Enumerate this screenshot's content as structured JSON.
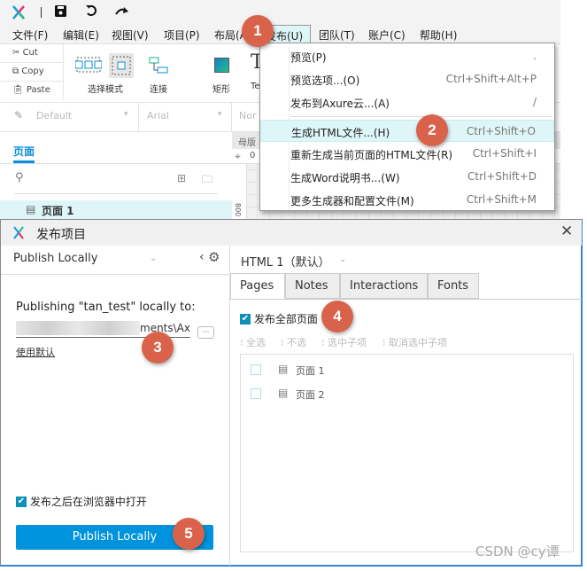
{
  "colors": {
    "accent": "#0093dd",
    "badge": "#d9634a",
    "highlight": "#dff6f8",
    "checkbox": "#0e90b8"
  },
  "titlebar": {
    "icons": [
      "axure-logo-icon",
      "save-icon",
      "undo-icon",
      "redo-icon"
    ]
  },
  "menubar": {
    "items": [
      "文件(F)",
      "编辑(E)",
      "视图(V)",
      "项目(P)",
      "布局(A)",
      "发布(U)",
      "团队(T)",
      "账户(C)",
      "帮助(H)"
    ],
    "active_index": 5
  },
  "toolbar": {
    "cut": "Cut",
    "copy": "Copy",
    "paste": "Paste",
    "select_mode": "选择模式",
    "connect": "连接",
    "rectangle": "矩形",
    "text": "Te"
  },
  "stylebar": {
    "style": "Default",
    "font": "Arial",
    "weight": "Nor"
  },
  "pages_panel": {
    "tab": "页面",
    "items": [
      "页面 1"
    ],
    "masters_tab": "母版",
    "ruler_zero": "0",
    "ruler_side": "800"
  },
  "publish_menu": {
    "items": [
      {
        "label": "预览(P)",
        "shortcut": "."
      },
      {
        "label": "预览选项...(O)",
        "shortcut": "Ctrl+Shift+Alt+P"
      },
      {
        "label": "发布到Axure云...(A)",
        "shortcut": "/"
      },
      {
        "label": "生成HTML文件...(H)",
        "shortcut": "Ctrl+Shift+O",
        "highlighted": true
      },
      {
        "label": "重新生成当前页面的HTML文件(R)",
        "shortcut": "Ctrl+Shift+I"
      },
      {
        "label": "生成Word说明书...(W)",
        "shortcut": "Ctrl+Shift+D"
      },
      {
        "label": "更多生成器和配置文件(M)",
        "shortcut": "Ctrl+Shift+M"
      }
    ]
  },
  "dialog": {
    "title": "发布项目",
    "target": "Publish Locally",
    "publishing_text": "Publishing \"tan_test\" locally to:",
    "path_visible": "ments\\Ax",
    "browse": "···",
    "use_default": "使用默认",
    "open_after": "发布之后在浏览器中打开",
    "open_after_checked": true,
    "publish_button": "Publish Locally",
    "config": "HTML 1（默认）",
    "tabs": [
      "Pages",
      "Notes",
      "Interactions",
      "Fonts"
    ],
    "active_tab": "Pages",
    "publish_all": "发布全部页面",
    "publish_all_checked": true,
    "select_tools": [
      "全选",
      "不选",
      "选中子项",
      "取消选中子项"
    ],
    "pages": [
      "页面 1",
      "页面 2"
    ]
  },
  "badges": [
    "1",
    "2",
    "3",
    "4",
    "5"
  ],
  "watermark": "CSDN @cy谭"
}
